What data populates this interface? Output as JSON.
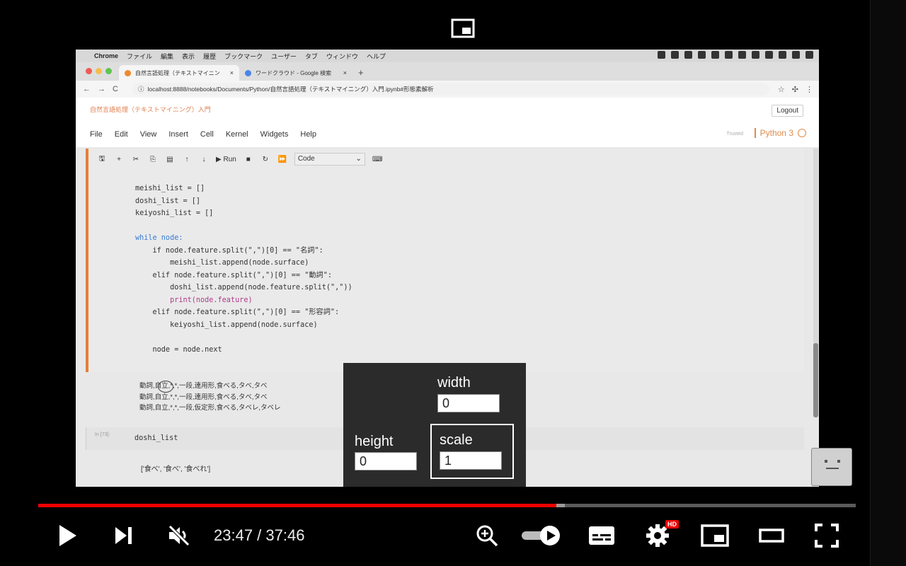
{
  "mac_menu": {
    "app": "Chrome",
    "items": [
      "ファイル",
      "編集",
      "表示",
      "履歴",
      "ブックマーク",
      "ユーザー",
      "タブ",
      "ウィンドウ",
      "ヘルプ"
    ]
  },
  "tabs": [
    {
      "label": "自然言語処理（テキストマイニン",
      "close": "×"
    },
    {
      "label": "ワードクラウド - Google 検索",
      "close": "×"
    }
  ],
  "new_tab": "+",
  "address": {
    "url": "localhost:8888/notebooks/Documents/Python/自然言語処理（テキストマイニング）入門.ipynb#形態素解析"
  },
  "jupyter": {
    "notebook_title": "自然言語処理（テキストマイニング）入門",
    "logout": "Logout",
    "menu": [
      "File",
      "Edit",
      "View",
      "Insert",
      "Cell",
      "Kernel",
      "Widgets",
      "Help"
    ],
    "trusted": "Trusted",
    "kernel": "Python 3",
    "toolbar": {
      "run": "Run",
      "cell_type": "Code"
    }
  },
  "code_lines": [
    "meishi_list = []",
    "doshi_list = []",
    "keiyoshi_list = []",
    "",
    "while node:",
    "    if node.feature.split(\",\")[0] == \"名詞\":",
    "        meishi_list.append(node.surface)",
    "    elif node.feature.split(\",\")[0] == \"動詞\":",
    "        doshi_list.append(node.feature.split(\",\"))",
    "        print(node.feature)",
    "    elif node.feature.split(\",\")[0] == \"形容詞\":",
    "        keiyoshi_list.append(node.surface)",
    "",
    "    node = node.next"
  ],
  "output_lines": [
    "動詞,自立,*,*,一段,連用形,食べる,タベ,タベ",
    "動詞,自立,*,*,一段,連用形,食べる,タベ,タベ",
    "動詞,自立,*,*,一段,仮定形,食べる,タベレ,タベレ"
  ],
  "cell2": {
    "prompt": "In [73]:",
    "source": "doshi_list",
    "output": "['食べ', '食べ', '食べれ']"
  },
  "overlay": {
    "width_label": "width",
    "width_value": "0",
    "height_label": "height",
    "height_value": "0",
    "scale_label": "scale",
    "scale_value": "1"
  },
  "player": {
    "time": "23:47 / 37:46",
    "progress": 0.6339,
    "buffered": 0.6445,
    "hd_badge": "HD",
    "colors": {
      "progress": "#ee0000",
      "buffer": "#9a9a9a"
    }
  }
}
